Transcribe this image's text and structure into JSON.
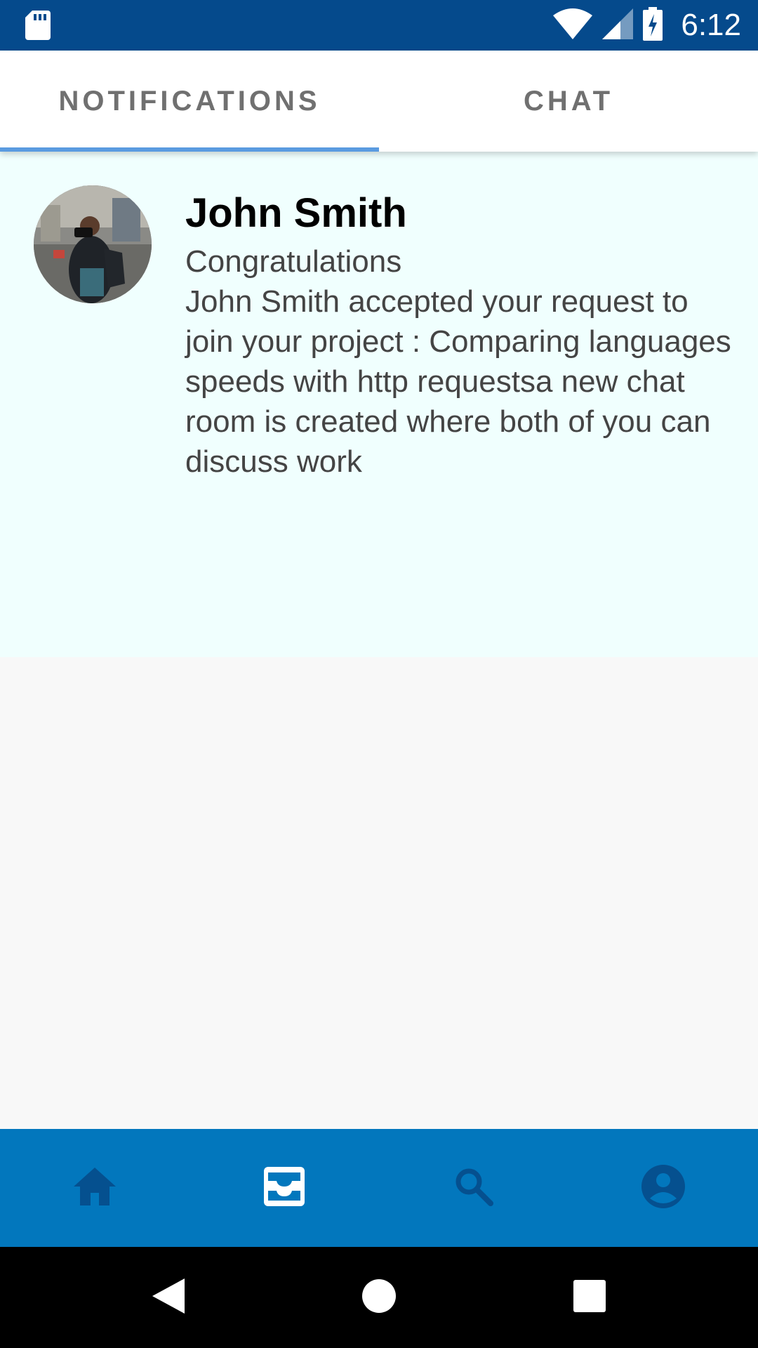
{
  "status_bar": {
    "time": "6:12",
    "icons": [
      "sd-card-icon",
      "wifi-icon",
      "cell-signal-icon",
      "battery-charging-icon"
    ]
  },
  "tabs": [
    {
      "label": "NOTIFICATIONS",
      "active": true
    },
    {
      "label": "CHAT",
      "active": false
    }
  ],
  "notifications": [
    {
      "name": "John Smith",
      "title": "Congratulations",
      "body": "John Smith accepted your request to join your project : Comparing languages speeds with http requestsa new chat room is created where both of you can discuss work"
    }
  ],
  "bottom_nav": {
    "items": [
      {
        "icon": "home-icon",
        "active": false
      },
      {
        "icon": "inbox-icon",
        "active": true
      },
      {
        "icon": "search-icon",
        "active": false
      },
      {
        "icon": "account-icon",
        "active": false
      }
    ],
    "colors": {
      "background": "#0277bd",
      "active": "#ffffff",
      "inactive": "#05508f"
    }
  },
  "system_nav": {
    "icons": [
      "back-icon",
      "home-circle-icon",
      "recents-icon"
    ]
  }
}
